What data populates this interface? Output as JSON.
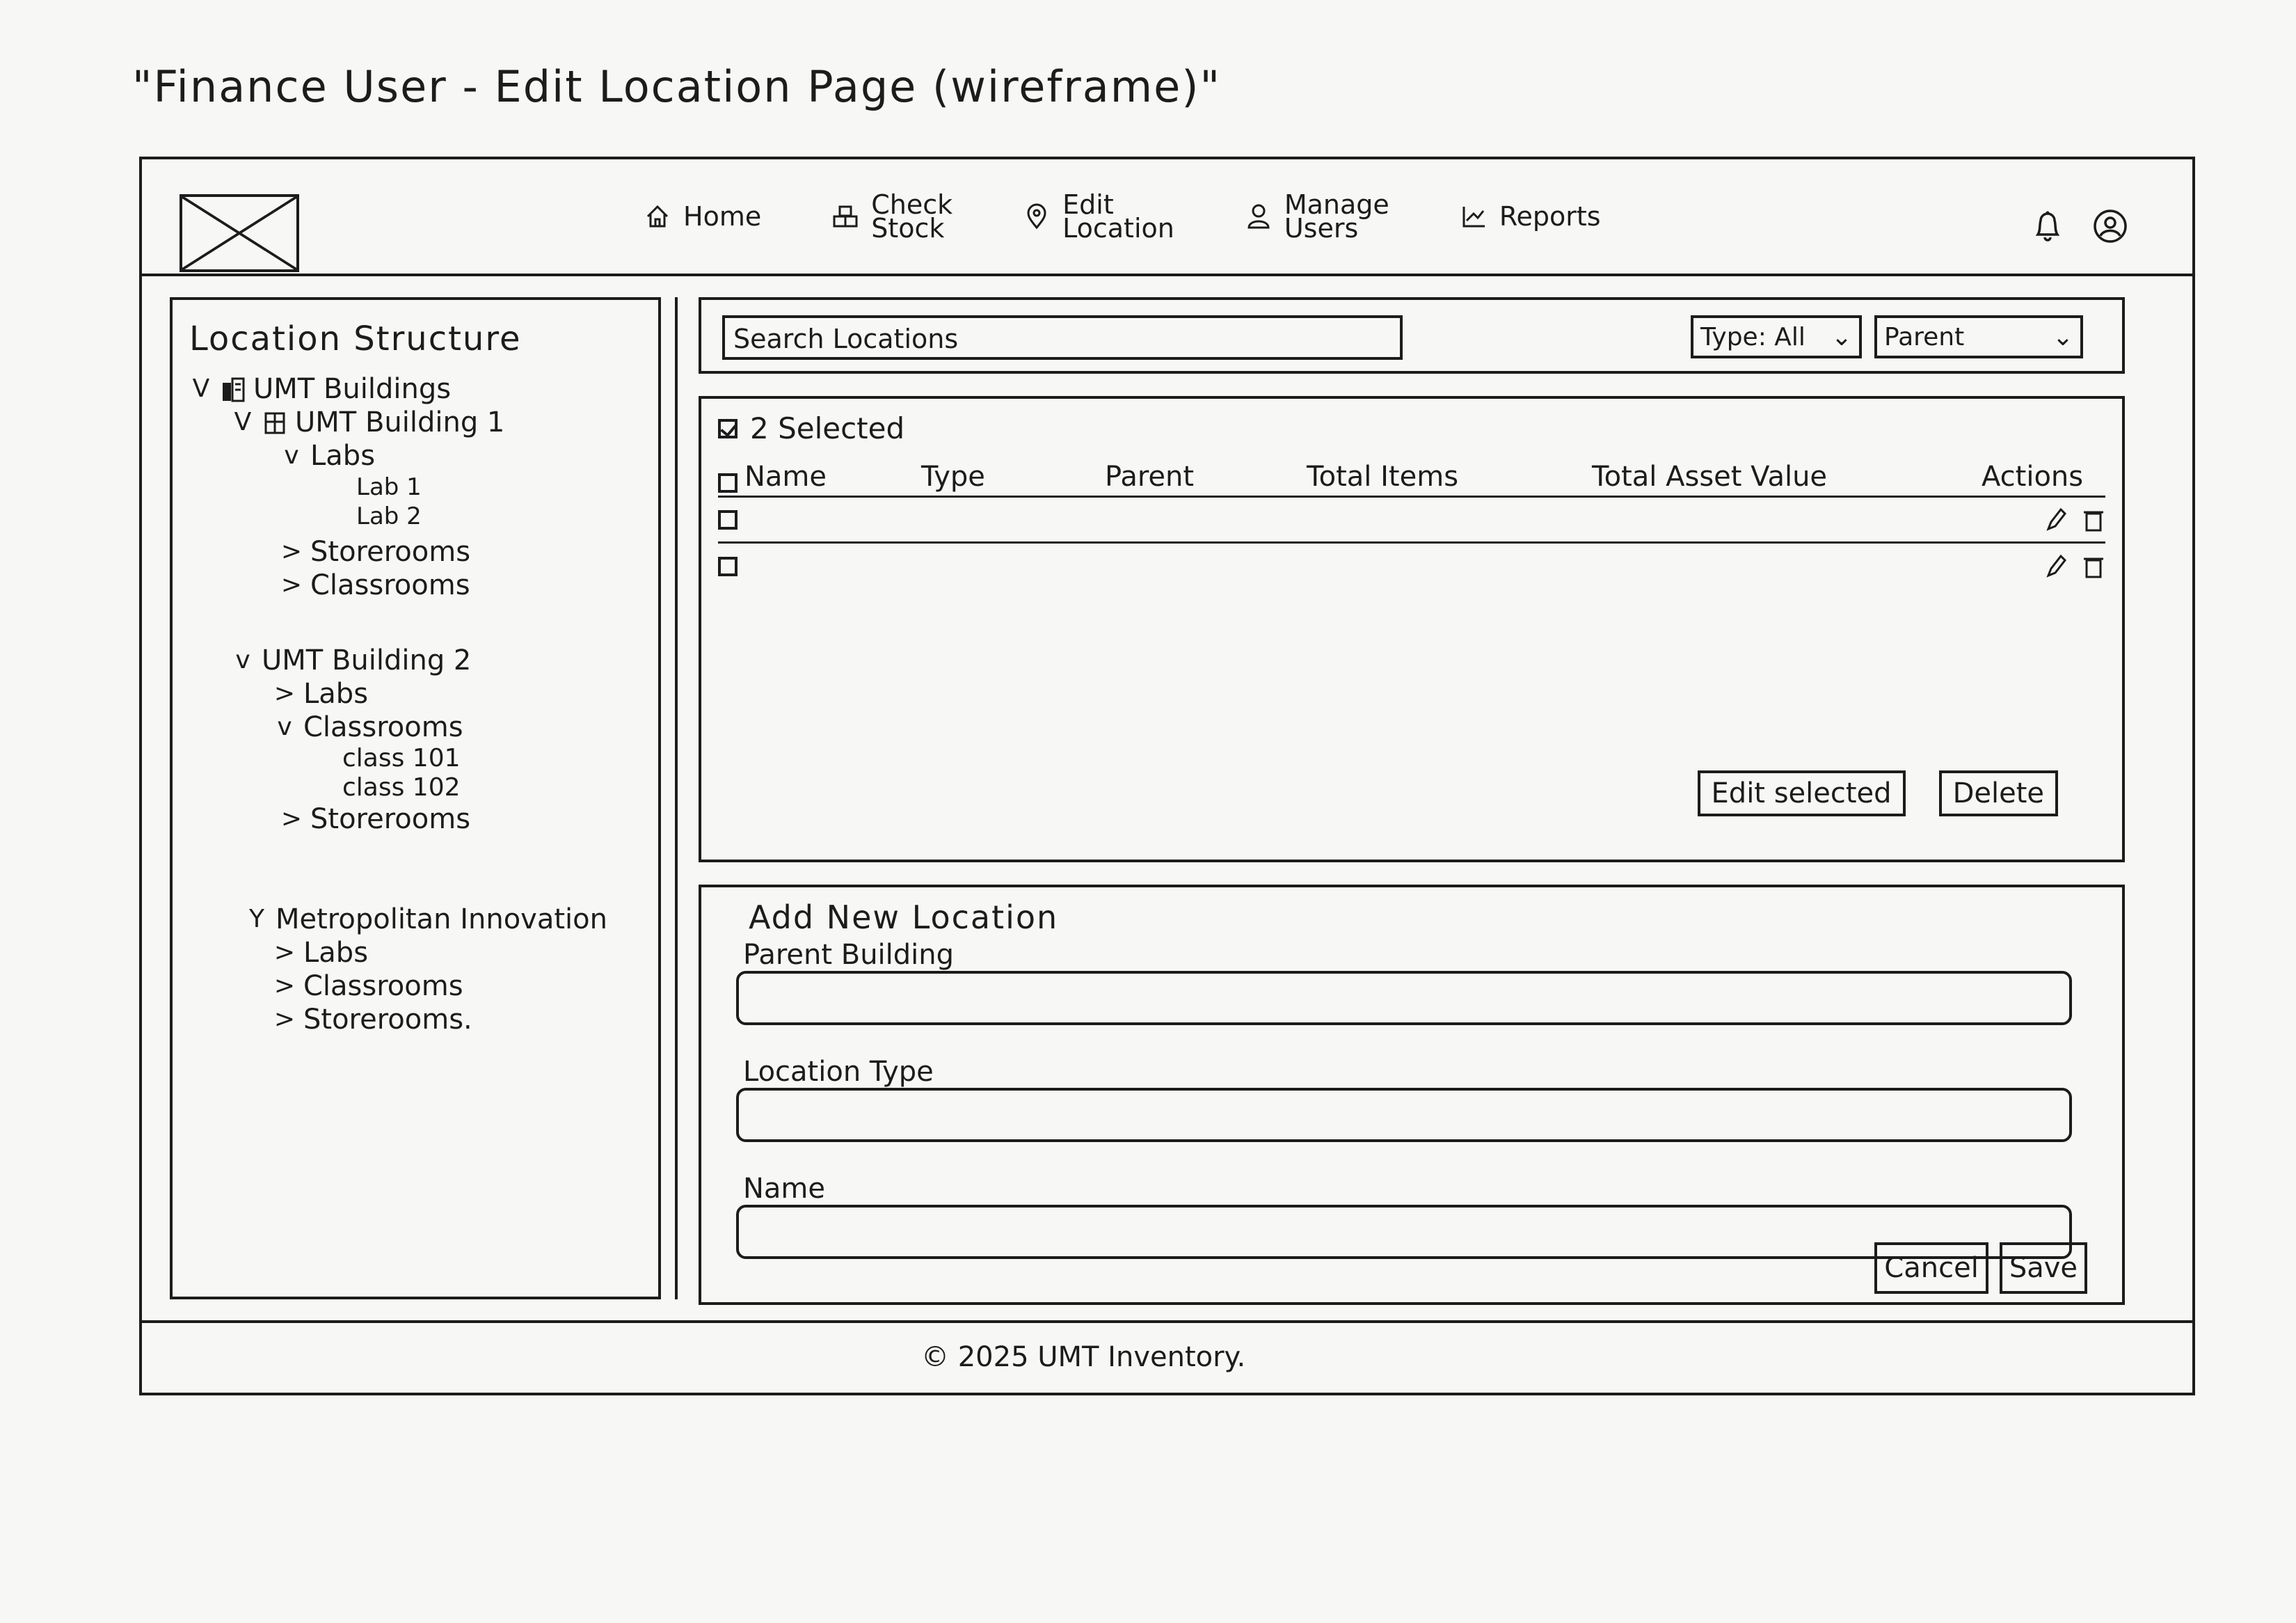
{
  "page_title": "\"Finance User - Edit Location Page (wireframe)\"",
  "nav": {
    "items": [
      {
        "icon": "home-icon",
        "label": "Home"
      },
      {
        "icon": "boxes-icon",
        "line1": "Check",
        "line2": "Stock"
      },
      {
        "icon": "location-pin-icon",
        "line1": "Edit",
        "line2": "Location"
      },
      {
        "icon": "user-icon",
        "line1": "Manage",
        "line2": "Users"
      },
      {
        "icon": "chart-icon",
        "label": "Reports"
      }
    ]
  },
  "sidebar": {
    "title": "Location Structure",
    "tree": {
      "root": {
        "caret": "V",
        "label": "UMT Buildings"
      },
      "b1": {
        "caret": "V",
        "label": "UMT Building 1",
        "labs": {
          "caret": "v",
          "label": "Labs",
          "children": [
            "Lab 1",
            "Lab 2"
          ]
        },
        "storerooms": {
          "caret": ">",
          "label": "Storerooms"
        },
        "classrooms": {
          "caret": ">",
          "label": "Classrooms"
        }
      },
      "b2": {
        "caret": "v",
        "label": "UMT Building 2",
        "labs": {
          "caret": ">",
          "label": "Labs"
        },
        "classrooms": {
          "caret": "v",
          "label": "Classrooms",
          "children": [
            "class 101",
            "class 102"
          ]
        },
        "storerooms": {
          "caret": ">",
          "label": "Storerooms"
        }
      },
      "b3": {
        "caret": "Y",
        "label": "Metropolitan Innovation",
        "labs": {
          "caret": ">",
          "label": "Labs"
        },
        "classrooms": {
          "caret": ">",
          "label": "Classrooms"
        },
        "storerooms": {
          "caret": ">",
          "label": "Storerooms."
        }
      }
    }
  },
  "toolbar": {
    "search_placeholder": "Search Locations",
    "type_filter": "Type: All",
    "parent_filter": "Parent"
  },
  "table": {
    "selected_label": "2 Selected",
    "columns": [
      "Name",
      "Type",
      "Parent",
      "Total Items",
      "Total Asset Value",
      "Actions"
    ],
    "edit_selected": "Edit selected",
    "delete": "Delete"
  },
  "form": {
    "title": "Add New Location",
    "parent_building_label": "Parent Building",
    "location_type_label": "Location Type",
    "name_label": "Name",
    "cancel": "Cancel",
    "save": "Save"
  },
  "footer": {
    "copyright": "© 2025 UMT Inventory."
  }
}
